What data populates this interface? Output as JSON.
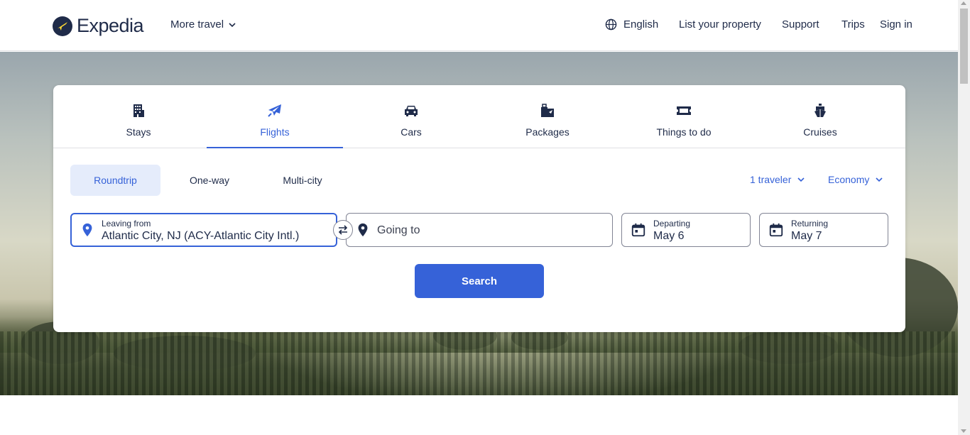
{
  "header": {
    "logo_text": "Expedia",
    "more_travel": "More travel",
    "language": "English",
    "list_property": "List your property",
    "support": "Support",
    "trips": "Trips",
    "sign_in": "Sign in"
  },
  "tabs": [
    {
      "label": "Stays",
      "icon": "building-icon",
      "active": false
    },
    {
      "label": "Flights",
      "icon": "plane-icon",
      "active": true
    },
    {
      "label": "Cars",
      "icon": "car-icon",
      "active": false
    },
    {
      "label": "Packages",
      "icon": "packages-icon",
      "active": false
    },
    {
      "label": "Things to do",
      "icon": "ticket-icon",
      "active": false
    },
    {
      "label": "Cruises",
      "icon": "cruise-icon",
      "active": false
    }
  ],
  "trip_types": {
    "roundtrip": "Roundtrip",
    "oneway": "One-way",
    "multicity": "Multi-city",
    "selected": "Roundtrip"
  },
  "options": {
    "travelers": "1 traveler",
    "cabin_class": "Economy"
  },
  "form": {
    "leaving_label": "Leaving from",
    "leaving_value": "Atlantic City, NJ (ACY-Atlantic City Intl.)",
    "going_placeholder": "Going to",
    "departing_label": "Departing",
    "departing_value": "May 6",
    "returning_label": "Returning",
    "returning_value": "May 7"
  },
  "search_button": "Search",
  "colors": {
    "brand_navy": "#1f2b49",
    "accent_blue": "#3662d8",
    "selected_bg": "#e5ecfb",
    "border": "#818494"
  }
}
